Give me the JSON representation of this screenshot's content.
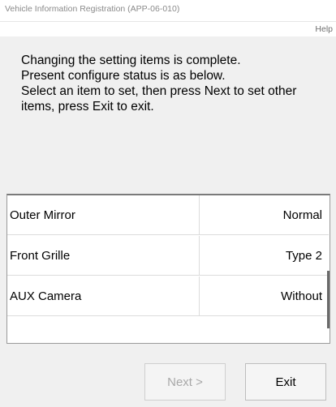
{
  "window": {
    "title": "Vehicle Information Registration (APP-06-010)"
  },
  "menu": {
    "help": "Help"
  },
  "message": {
    "lines": [
      "Changing the setting items is complete.",
      "Present configure status is as below.",
      "Select an item to set, then press Next to set other",
      "items, press Exit to exit."
    ]
  },
  "table": {
    "rows": [
      {
        "name": "Outer Mirror",
        "value": "Normal"
      },
      {
        "name": "Front Grille",
        "value": "Type 2"
      },
      {
        "name": "AUX Camera",
        "value": "Without"
      }
    ]
  },
  "buttons": {
    "next_label": "Next >",
    "next_enabled": false,
    "exit_label": "Exit"
  }
}
